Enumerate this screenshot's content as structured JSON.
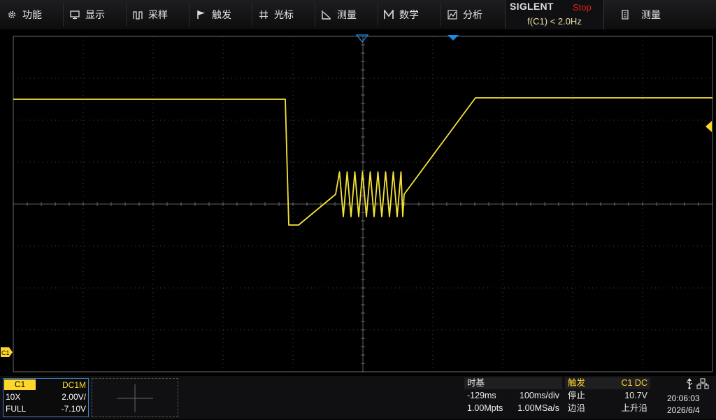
{
  "menu": {
    "items": [
      {
        "label": "功能",
        "icon": "gear-icon"
      },
      {
        "label": "显示",
        "icon": "monitor-icon"
      },
      {
        "label": "采样",
        "icon": "acquire-icon"
      },
      {
        "label": "触发",
        "icon": "flag-icon"
      },
      {
        "label": "光标",
        "icon": "cursor-cross-icon"
      },
      {
        "label": "测量",
        "icon": "measure-icon"
      },
      {
        "label": "数学",
        "icon": "math-icon"
      },
      {
        "label": "分析",
        "icon": "analyze-icon"
      }
    ],
    "brand": "SIGLENT",
    "run_state": "Stop",
    "freq_readout": "f(C1) < 2.0Hz",
    "right_item": {
      "label": "测量",
      "icon": "document-icon"
    }
  },
  "colors": {
    "ch1": "#ffd62a",
    "trigger_marker": "#1e8ae6",
    "run_state": "#e0201c",
    "grid": "#5a5a5a"
  },
  "waveform": {
    "trace_color": "#f5e23a",
    "channel_label": "C1",
    "time_div_ms": 100,
    "volts_div": 2.0
  },
  "channel1": {
    "tag": "C1",
    "coupling": "DC1M",
    "probe": "10X",
    "scale": "2.00V/",
    "bandwidth": "FULL",
    "offset": "-7.10V"
  },
  "timebase": {
    "title": "时基",
    "delay": "-129ms",
    "scale": "100ms/div",
    "memory": "1.00Mpts",
    "sample_rate": "1.00MSa/s"
  },
  "trigger": {
    "title": "触发",
    "source": "C1 DC",
    "state": "停止",
    "level": "10.7V",
    "type": "边沿",
    "slope": "上升沿"
  },
  "clock": {
    "time": "20:06:03",
    "date": "2026/6/4"
  }
}
